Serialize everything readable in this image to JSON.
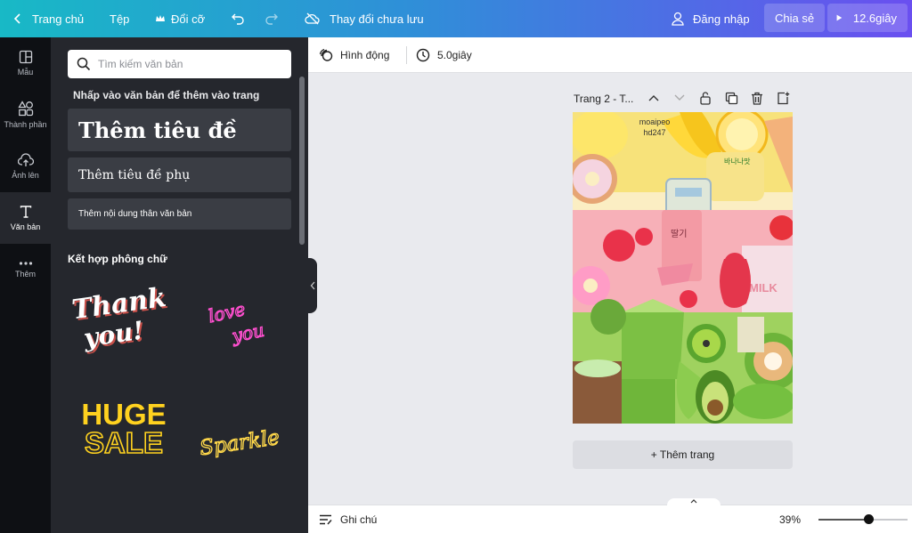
{
  "topbar": {
    "home": "Trang chủ",
    "file": "Tệp",
    "resize": "Đổi cỡ",
    "save_status": "Thay đổi chưa lưu",
    "login": "Đăng nhập",
    "share": "Chia sẻ",
    "play": "12.6giây",
    "icons": [
      "chevron-left-icon",
      "crown-icon",
      "undo-icon",
      "redo-icon",
      "cloud-off-icon",
      "user-icon",
      "play-icon"
    ]
  },
  "rail": {
    "items": [
      {
        "label": "Mẫu",
        "icon": "template-icon"
      },
      {
        "label": "Thành phần",
        "icon": "shapes-icon"
      },
      {
        "label": "Ảnh lên",
        "icon": "upload-icon"
      },
      {
        "label": "Văn bản",
        "icon": "text-icon",
        "active": true
      },
      {
        "label": "Thêm",
        "icon": "more-icon"
      }
    ]
  },
  "panel": {
    "search_placeholder": "Tìm kiếm văn bản",
    "hint": "Nhấp vào văn bản để thêm vào trang",
    "heading": "Thêm tiêu đề",
    "subheading": "Thêm tiêu đề phụ",
    "body": "Thêm nội dung thân văn bản",
    "combos_title": "Kết hợp phông chữ",
    "combos": [
      {
        "text": "Thank you!",
        "color": "#ffffff"
      },
      {
        "text": "love you",
        "color": "#ff4fcf"
      },
      {
        "text": "HUGE SALE",
        "color": "#ffd21f"
      },
      {
        "text": "Sparkle",
        "color": "#ffd84a"
      }
    ]
  },
  "editor": {
    "animate": "Hình động",
    "duration": "5.0giây",
    "page_label": "Trang 2 - T...",
    "watermark_line1": "moaipeo",
    "watermark_line2": "hd247",
    "add_page": "+ Thêm trang",
    "notes": "Ghi chú",
    "zoom": "39%",
    "zoom_fraction": 0.39
  }
}
